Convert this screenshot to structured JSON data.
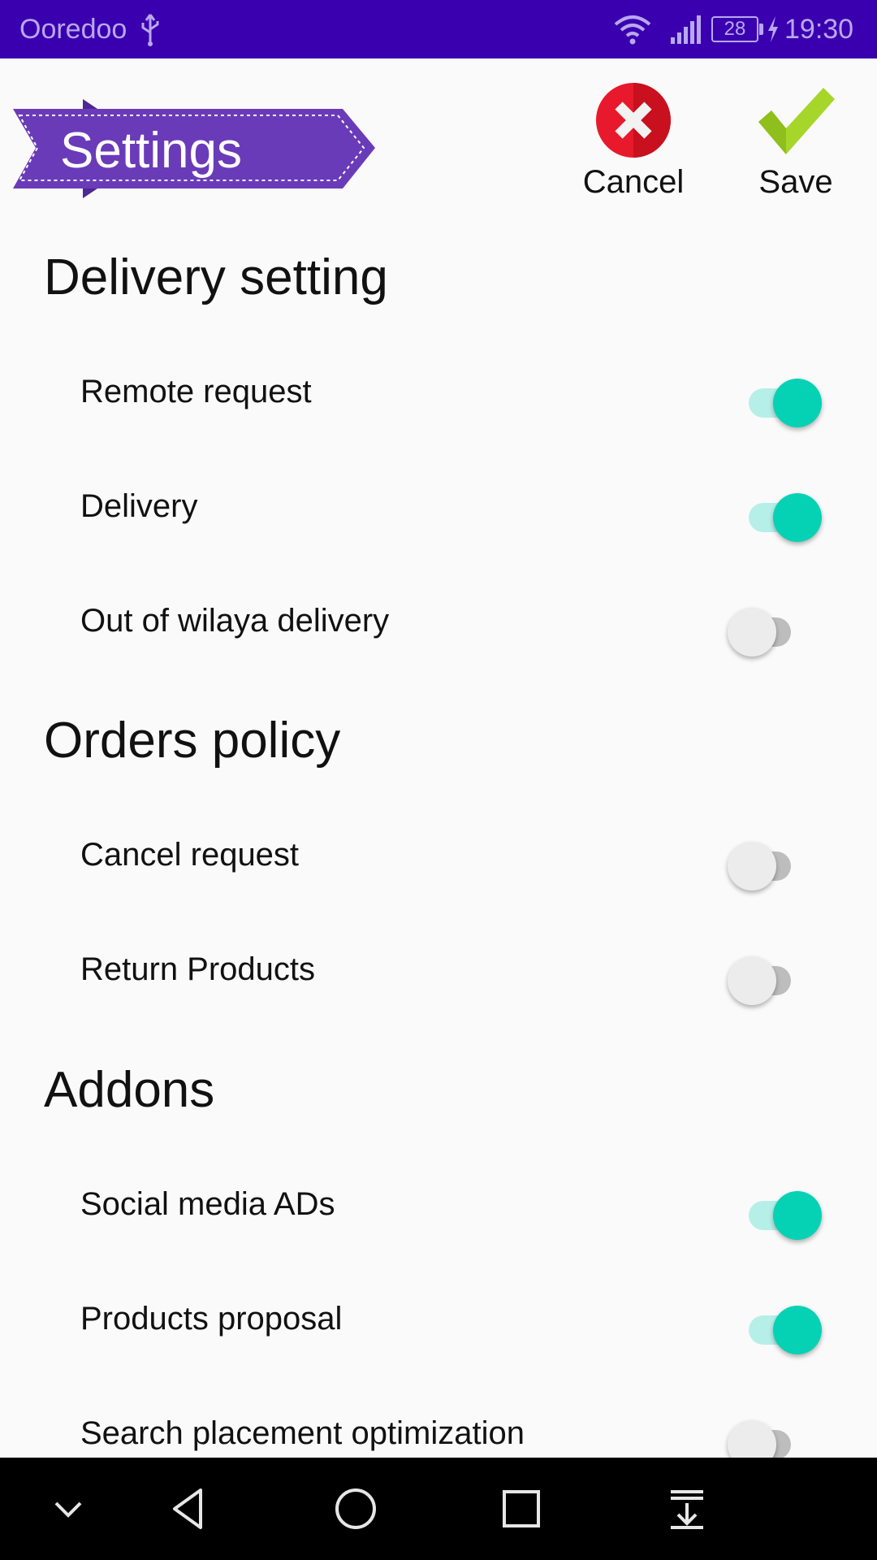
{
  "status_bar": {
    "carrier": "Ooredoo",
    "battery": "28",
    "time": "19:30",
    "icons": [
      "usb-icon",
      "wifi-icon",
      "signal-icon",
      "battery-icon",
      "charging-icon"
    ]
  },
  "header": {
    "title": "Settings",
    "cancel_label": "Cancel",
    "save_label": "Save"
  },
  "sections": [
    {
      "title": "Delivery setting",
      "items": [
        {
          "label": "Remote request",
          "enabled": true
        },
        {
          "label": "Delivery",
          "enabled": true
        },
        {
          "label": "Out of wilaya delivery",
          "enabled": false
        }
      ]
    },
    {
      "title": "Orders policy",
      "items": [
        {
          "label": "Cancel request",
          "enabled": false
        },
        {
          "label": "Return Products",
          "enabled": false
        }
      ]
    },
    {
      "title": "Addons",
      "items": [
        {
          "label": "Social media ADs",
          "enabled": true
        },
        {
          "label": "Products proposal",
          "enabled": true
        },
        {
          "label": "Search placement optimization",
          "enabled": false
        }
      ]
    }
  ],
  "colors": {
    "status_bar": "#3a00b0",
    "banner": "#6a3bb8",
    "switch_on": "#05d2b5",
    "switch_on_track": "#b6efe8",
    "cancel": "#e8192c",
    "save": "#a6d62a"
  },
  "nav_bar": [
    "collapse-icon",
    "back-icon",
    "home-icon",
    "recents-icon",
    "notification-pull-icon"
  ]
}
